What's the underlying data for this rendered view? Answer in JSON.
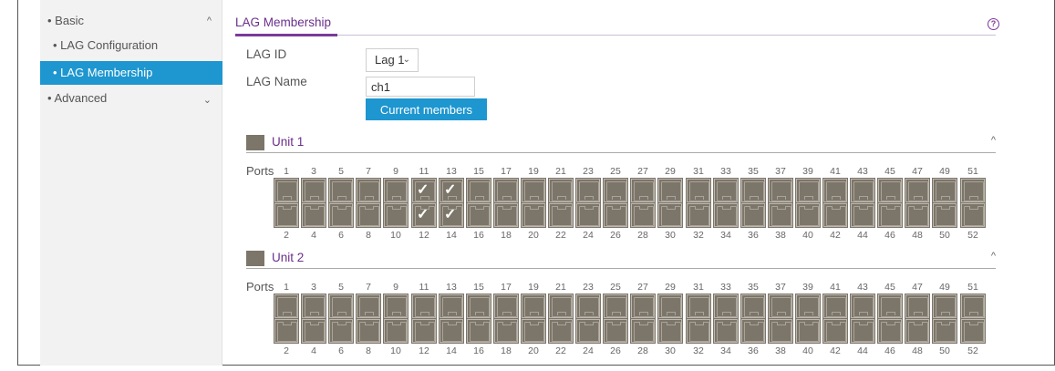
{
  "sidebar": {
    "items": [
      {
        "label": "Basic",
        "chevron": "^",
        "level": 1,
        "active": false,
        "icon": "chevron-up-icon"
      },
      {
        "label": "LAG Configuration",
        "level": 2,
        "active": false
      },
      {
        "label": "LAG Membership",
        "level": 2,
        "active": true
      },
      {
        "label": "Advanced",
        "chevron": "⌄",
        "level": 1,
        "active": false,
        "icon": "chevron-down-icon"
      }
    ]
  },
  "main": {
    "title": "LAG Membership",
    "help_icon": "?",
    "lag_id_label": "LAG ID",
    "lag_id_value": "Lag 1",
    "lag_name_label": "LAG Name",
    "lag_name_value": "ch1",
    "current_members_label": "Current members"
  },
  "units": [
    {
      "name": "Unit 1",
      "ports_label": "Ports",
      "odd_ports": [
        "1",
        "3",
        "5",
        "7",
        "9",
        "11",
        "13",
        "15",
        "17",
        "19",
        "21",
        "23",
        "25",
        "27",
        "29",
        "31",
        "33",
        "35",
        "37",
        "39",
        "41",
        "43",
        "45",
        "47",
        "49",
        "51"
      ],
      "even_ports": [
        "2",
        "4",
        "6",
        "8",
        "10",
        "12",
        "14",
        "16",
        "18",
        "20",
        "22",
        "24",
        "26",
        "28",
        "30",
        "32",
        "34",
        "36",
        "38",
        "40",
        "42",
        "44",
        "46",
        "48",
        "50",
        "52"
      ],
      "checked": [
        "11",
        "12",
        "13",
        "14"
      ]
    },
    {
      "name": "Unit 2",
      "ports_label": "Ports",
      "odd_ports": [
        "1",
        "3",
        "5",
        "7",
        "9",
        "11",
        "13",
        "15",
        "17",
        "19",
        "21",
        "23",
        "25",
        "27",
        "29",
        "31",
        "33",
        "35",
        "37",
        "39",
        "41",
        "43",
        "45",
        "47",
        "49",
        "51"
      ],
      "even_ports": [
        "2",
        "4",
        "6",
        "8",
        "10",
        "12",
        "14",
        "16",
        "18",
        "20",
        "22",
        "24",
        "26",
        "28",
        "30",
        "32",
        "34",
        "36",
        "38",
        "40",
        "42",
        "44",
        "46",
        "48",
        "50",
        "52"
      ],
      "checked": []
    }
  ],
  "colors": {
    "accent_blue": "#1e96cf",
    "title_purple": "#6a2f8c",
    "port_brown": "#7c7569"
  }
}
